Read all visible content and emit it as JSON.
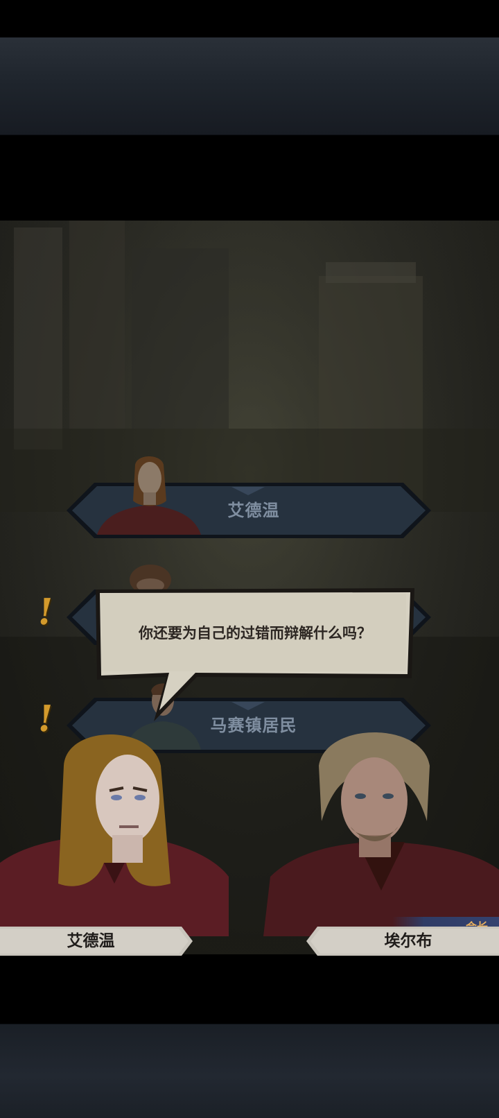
{
  "dialogue": {
    "options": [
      {
        "label": "艾德温"
      },
      {
        "label": ""
      },
      {
        "label": "马赛镇居民"
      }
    ],
    "speech": "你还要为自己的过错而辩解什么吗？"
  },
  "speakers": {
    "left": {
      "name": "艾德温"
    },
    "right": {
      "name": "埃尔布",
      "title": "会长"
    }
  },
  "quest_marker": "!",
  "colors": {
    "option_fill": "#253140",
    "option_text": "#7f8ea0",
    "marker": "#d39a2c",
    "bubble": "#d8d3c5",
    "nameplate": "#cfccc5",
    "title_tag_text": "#e8b060"
  }
}
